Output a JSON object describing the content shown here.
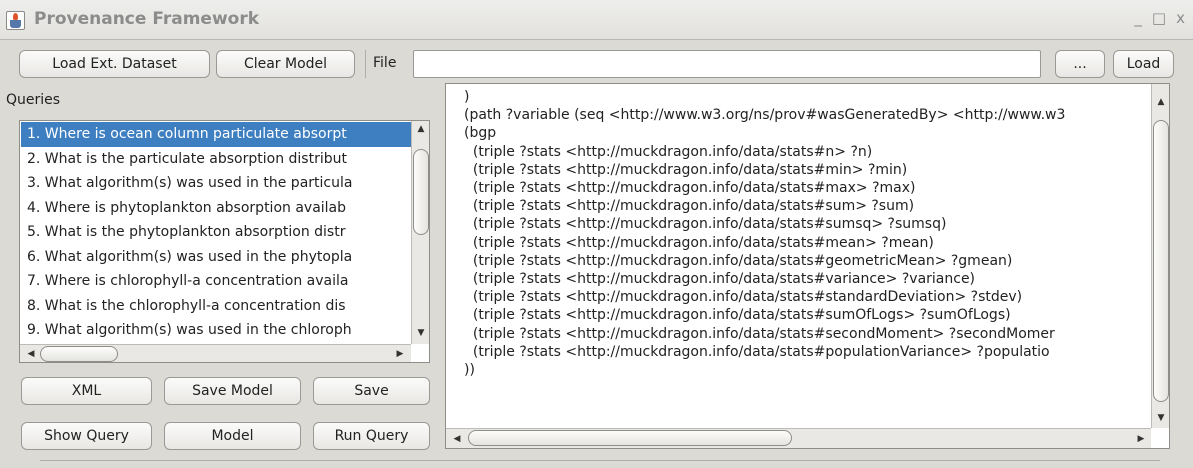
{
  "window": {
    "title": "Provenance Framework",
    "controls": [
      "_",
      "□",
      "x"
    ]
  },
  "toolbar": {
    "load_ext_dataset": "Load Ext. Dataset",
    "clear_model": "Clear Model",
    "file_label": "File",
    "file_value": "",
    "browse": "...",
    "load": "Load"
  },
  "queries": {
    "label": "Queries",
    "items": [
      "1. Where is ocean column particulate absorpt",
      "2. What is the particulate absorption distribut",
      "3. What algorithm(s) was used in the particula",
      "4. Where is phytoplankton absorption availab",
      "5. What is the phytoplankton absorption distr",
      "6. What algorithm(s) was used in the phytopla",
      "7. Where is chlorophyll-a concentration availa",
      "8. What is the chlorophyll-a concentration dis",
      "9. What algorithm(s) was used in the chloroph"
    ],
    "selected_index": 0
  },
  "actions": {
    "xml": "XML",
    "save_model": "Save Model",
    "save": "Save",
    "show_query": "Show Query",
    "model": "Model",
    "run_query": "Run Query"
  },
  "query_text": {
    "lines": [
      ")",
      "(path ?variable (seq <http://www.w3.org/ns/prov#wasGeneratedBy> <http://www.w3",
      "(bgp",
      "  (triple ?stats <http://muckdragon.info/data/stats#n> ?n)",
      "  (triple ?stats <http://muckdragon.info/data/stats#min> ?min)",
      "  (triple ?stats <http://muckdragon.info/data/stats#max> ?max)",
      "  (triple ?stats <http://muckdragon.info/data/stats#sum> ?sum)",
      "  (triple ?stats <http://muckdragon.info/data/stats#sumsq> ?sumsq)",
      "  (triple ?stats <http://muckdragon.info/data/stats#mean> ?mean)",
      "  (triple ?stats <http://muckdragon.info/data/stats#geometricMean> ?gmean)",
      "  (triple ?stats <http://muckdragon.info/data/stats#variance> ?variance)",
      "  (triple ?stats <http://muckdragon.info/data/stats#standardDeviation> ?stdev)",
      "  (triple ?stats <http://muckdragon.info/data/stats#sumOfLogs> ?sumOfLogs)",
      "  (triple ?stats <http://muckdragon.info/data/stats#secondMoment> ?secondMomer",
      "  (triple ?stats <http://muckdragon.info/data/stats#populationVariance> ?populatio",
      "))"
    ]
  },
  "colors": {
    "selection": "#3d7fc1",
    "window_bg": "#dcdad5"
  }
}
